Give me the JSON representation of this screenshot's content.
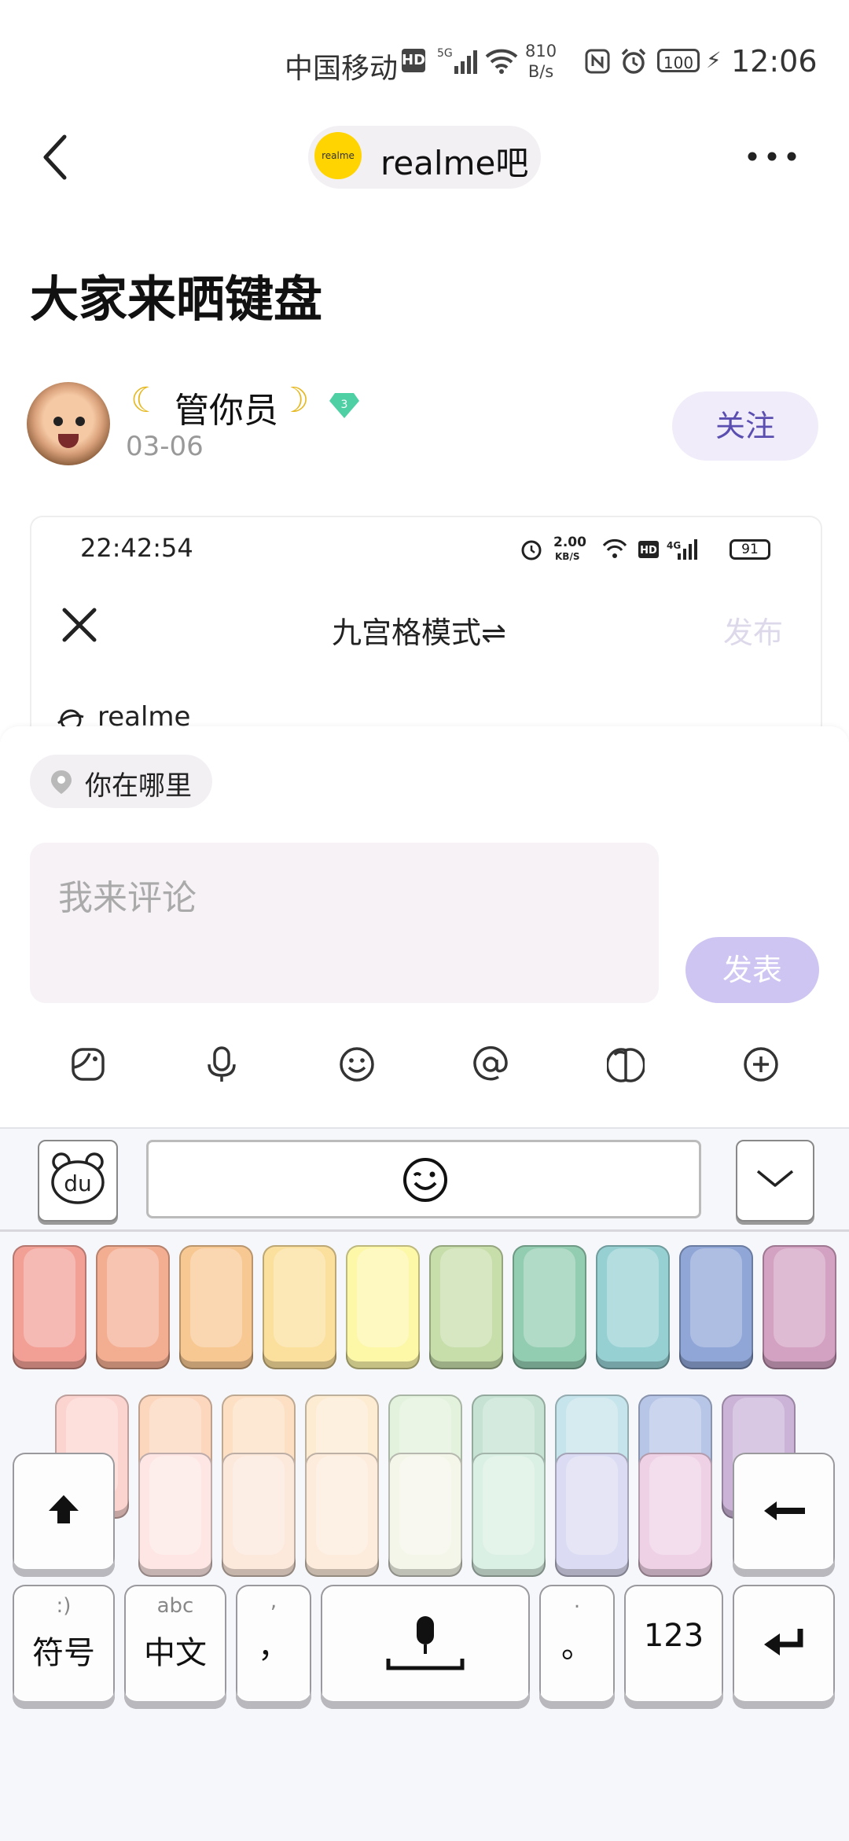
{
  "status_bar": {
    "carrier": "中国移动",
    "hd": "HD",
    "network": "5G",
    "speed_value": "810",
    "speed_unit": "B/s",
    "battery": "100",
    "time": "12:06"
  },
  "header": {
    "forum_logo_text": "realme",
    "forum_name": "realme吧"
  },
  "post": {
    "title": "大家来晒键盘",
    "author": "管你员",
    "level": "3",
    "date": "03-06",
    "follow_label": "关注"
  },
  "embedded_screenshot": {
    "time": "22:42:54",
    "speed_value": "2.00",
    "speed_unit": "KB/S",
    "hd": "HD",
    "network": "4G",
    "battery": "91",
    "mode_title": "九宫格模式⇌",
    "publish_label": "发布",
    "forum_text": "realme"
  },
  "comment": {
    "location_label": "你在哪里",
    "placeholder": "我来评论",
    "send_label": "发表",
    "toolbar_icons": [
      "sticker-icon",
      "microphone-icon",
      "emoji-icon",
      "mention-icon",
      "gift-icon",
      "add-icon"
    ]
  },
  "keyboard": {
    "logo_text": "du",
    "row1_colors": [
      "#f2a096",
      "#f3ae92",
      "#f8c893",
      "#fbdf9c",
      "#fdf7a8",
      "#c7deaa",
      "#93cdb1",
      "#97d0d3",
      "#8fa6d7",
      "#d3a1c2"
    ],
    "row2_colors": [
      "#fcd4cf",
      "#fcd6bd",
      "#fde0c3",
      "#fdebd2",
      "#e2f2dc",
      "#c5e2d3",
      "#c6e4eb",
      "#b7c5e7",
      "#cbb3d8"
    ],
    "row3_colors": [
      "#fde6e3",
      "#fde8dc",
      "#fdecdc",
      "#f5f6ea",
      "#daf0e4",
      "#dbdbf3",
      "#efd1e6"
    ],
    "symbols_label": "符号",
    "symbols_hint": ":)",
    "chinese_label": "中文",
    "chinese_hint": "abc",
    "comma_label": "，",
    "period_label": "。",
    "numbers_label": "123"
  }
}
